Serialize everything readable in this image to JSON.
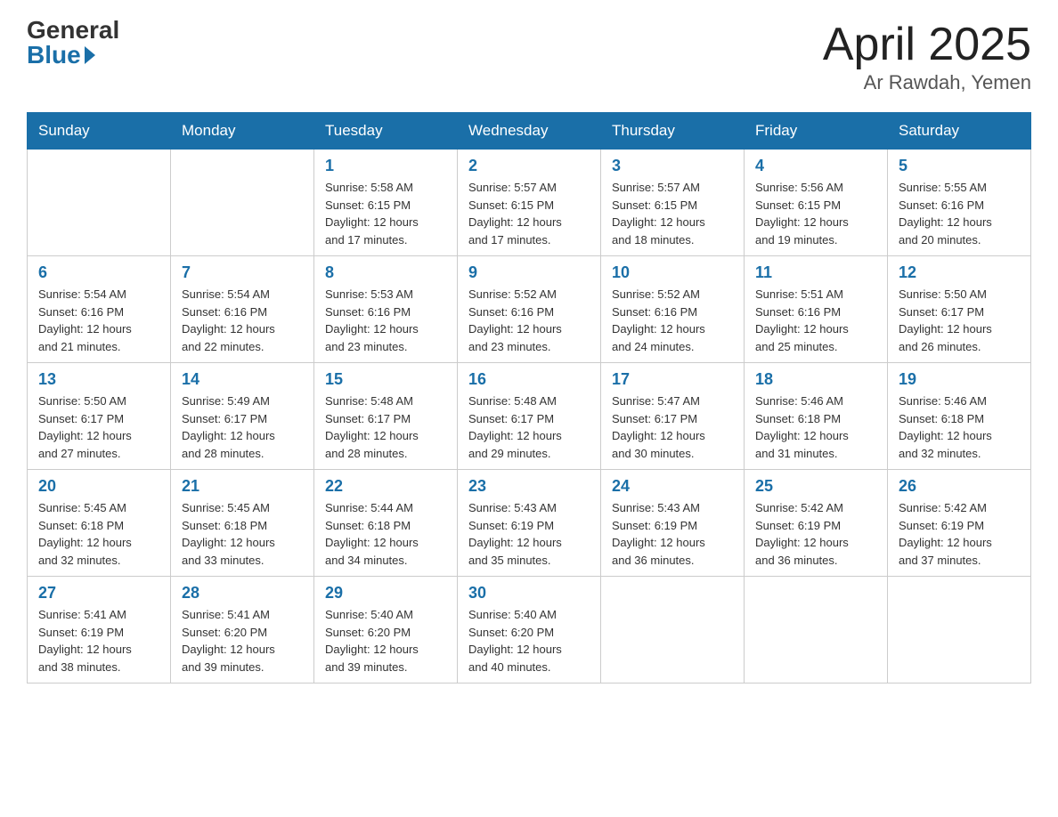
{
  "logo": {
    "general": "General",
    "blue": "Blue"
  },
  "title": "April 2025",
  "subtitle": "Ar Rawdah, Yemen",
  "days_of_week": [
    "Sunday",
    "Monday",
    "Tuesday",
    "Wednesday",
    "Thursday",
    "Friday",
    "Saturday"
  ],
  "weeks": [
    [
      {
        "day": "",
        "info": ""
      },
      {
        "day": "",
        "info": ""
      },
      {
        "day": "1",
        "info": "Sunrise: 5:58 AM\nSunset: 6:15 PM\nDaylight: 12 hours\nand 17 minutes."
      },
      {
        "day": "2",
        "info": "Sunrise: 5:57 AM\nSunset: 6:15 PM\nDaylight: 12 hours\nand 17 minutes."
      },
      {
        "day": "3",
        "info": "Sunrise: 5:57 AM\nSunset: 6:15 PM\nDaylight: 12 hours\nand 18 minutes."
      },
      {
        "day": "4",
        "info": "Sunrise: 5:56 AM\nSunset: 6:15 PM\nDaylight: 12 hours\nand 19 minutes."
      },
      {
        "day": "5",
        "info": "Sunrise: 5:55 AM\nSunset: 6:16 PM\nDaylight: 12 hours\nand 20 minutes."
      }
    ],
    [
      {
        "day": "6",
        "info": "Sunrise: 5:54 AM\nSunset: 6:16 PM\nDaylight: 12 hours\nand 21 minutes."
      },
      {
        "day": "7",
        "info": "Sunrise: 5:54 AM\nSunset: 6:16 PM\nDaylight: 12 hours\nand 22 minutes."
      },
      {
        "day": "8",
        "info": "Sunrise: 5:53 AM\nSunset: 6:16 PM\nDaylight: 12 hours\nand 23 minutes."
      },
      {
        "day": "9",
        "info": "Sunrise: 5:52 AM\nSunset: 6:16 PM\nDaylight: 12 hours\nand 23 minutes."
      },
      {
        "day": "10",
        "info": "Sunrise: 5:52 AM\nSunset: 6:16 PM\nDaylight: 12 hours\nand 24 minutes."
      },
      {
        "day": "11",
        "info": "Sunrise: 5:51 AM\nSunset: 6:16 PM\nDaylight: 12 hours\nand 25 minutes."
      },
      {
        "day": "12",
        "info": "Sunrise: 5:50 AM\nSunset: 6:17 PM\nDaylight: 12 hours\nand 26 minutes."
      }
    ],
    [
      {
        "day": "13",
        "info": "Sunrise: 5:50 AM\nSunset: 6:17 PM\nDaylight: 12 hours\nand 27 minutes."
      },
      {
        "day": "14",
        "info": "Sunrise: 5:49 AM\nSunset: 6:17 PM\nDaylight: 12 hours\nand 28 minutes."
      },
      {
        "day": "15",
        "info": "Sunrise: 5:48 AM\nSunset: 6:17 PM\nDaylight: 12 hours\nand 28 minutes."
      },
      {
        "day": "16",
        "info": "Sunrise: 5:48 AM\nSunset: 6:17 PM\nDaylight: 12 hours\nand 29 minutes."
      },
      {
        "day": "17",
        "info": "Sunrise: 5:47 AM\nSunset: 6:17 PM\nDaylight: 12 hours\nand 30 minutes."
      },
      {
        "day": "18",
        "info": "Sunrise: 5:46 AM\nSunset: 6:18 PM\nDaylight: 12 hours\nand 31 minutes."
      },
      {
        "day": "19",
        "info": "Sunrise: 5:46 AM\nSunset: 6:18 PM\nDaylight: 12 hours\nand 32 minutes."
      }
    ],
    [
      {
        "day": "20",
        "info": "Sunrise: 5:45 AM\nSunset: 6:18 PM\nDaylight: 12 hours\nand 32 minutes."
      },
      {
        "day": "21",
        "info": "Sunrise: 5:45 AM\nSunset: 6:18 PM\nDaylight: 12 hours\nand 33 minutes."
      },
      {
        "day": "22",
        "info": "Sunrise: 5:44 AM\nSunset: 6:18 PM\nDaylight: 12 hours\nand 34 minutes."
      },
      {
        "day": "23",
        "info": "Sunrise: 5:43 AM\nSunset: 6:19 PM\nDaylight: 12 hours\nand 35 minutes."
      },
      {
        "day": "24",
        "info": "Sunrise: 5:43 AM\nSunset: 6:19 PM\nDaylight: 12 hours\nand 36 minutes."
      },
      {
        "day": "25",
        "info": "Sunrise: 5:42 AM\nSunset: 6:19 PM\nDaylight: 12 hours\nand 36 minutes."
      },
      {
        "day": "26",
        "info": "Sunrise: 5:42 AM\nSunset: 6:19 PM\nDaylight: 12 hours\nand 37 minutes."
      }
    ],
    [
      {
        "day": "27",
        "info": "Sunrise: 5:41 AM\nSunset: 6:19 PM\nDaylight: 12 hours\nand 38 minutes."
      },
      {
        "day": "28",
        "info": "Sunrise: 5:41 AM\nSunset: 6:20 PM\nDaylight: 12 hours\nand 39 minutes."
      },
      {
        "day": "29",
        "info": "Sunrise: 5:40 AM\nSunset: 6:20 PM\nDaylight: 12 hours\nand 39 minutes."
      },
      {
        "day": "30",
        "info": "Sunrise: 5:40 AM\nSunset: 6:20 PM\nDaylight: 12 hours\nand 40 minutes."
      },
      {
        "day": "",
        "info": ""
      },
      {
        "day": "",
        "info": ""
      },
      {
        "day": "",
        "info": ""
      }
    ]
  ]
}
